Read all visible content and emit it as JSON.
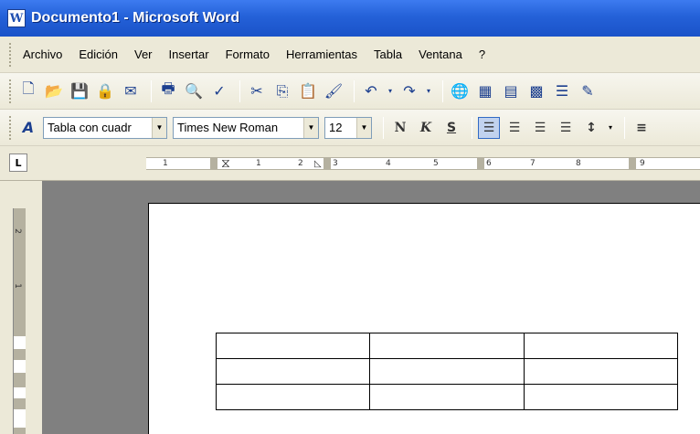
{
  "window": {
    "title": "Documento1 - Microsoft Word",
    "icon": "word-icon"
  },
  "menu": {
    "items": [
      "Archivo",
      "Edición",
      "Ver",
      "Insertar",
      "Formato",
      "Herramientas",
      "Tabla",
      "Ventana",
      "?"
    ]
  },
  "standard_toolbar": {
    "buttons": [
      "new-icon",
      "open-icon",
      "save-icon",
      "permission-icon",
      "email-icon",
      "print-icon",
      "print-preview-icon",
      "spelling-icon",
      "cut-icon",
      "copy-icon",
      "paste-icon",
      "format-painter-icon",
      "undo-icon",
      "redo-icon",
      "hyperlink-icon",
      "tables-borders-icon",
      "insert-table-icon",
      "insert-excel-icon",
      "columns-icon",
      "drawing-icon"
    ]
  },
  "formatting_toolbar": {
    "style_value": "Tabla con cuadr",
    "font_value": "Times New Roman",
    "size_value": "12",
    "bold_glyph": "N",
    "italic_glyph": "K",
    "underline_glyph": "S"
  },
  "tab_selector": "L",
  "ruler": {
    "marks": [
      "1",
      "1",
      "2",
      "3",
      "4",
      "5",
      "6",
      "7",
      "8",
      "9"
    ]
  },
  "vruler": {
    "marks": [
      "2",
      "1"
    ]
  },
  "table": {
    "rows": 3,
    "cols": 3
  }
}
